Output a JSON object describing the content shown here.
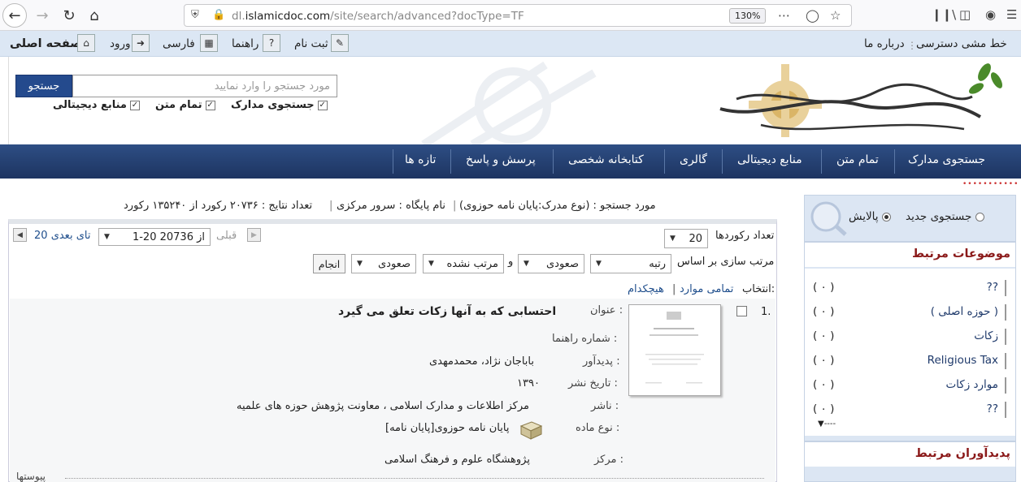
{
  "browser": {
    "url_prefix": "dl.",
    "url_domain": "islamicdoc.com",
    "url_path": "/site/search/advanced?docType=TF",
    "zoom": "130%"
  },
  "topstrip": {
    "home": "صفحه اصلی",
    "login": "ورود",
    "farsi": "فارسی",
    "help": "راهنما",
    "register": "ثبت نام",
    "accessibility": "خط مشی دسترسی",
    "about": "درباره ما"
  },
  "header": {
    "search_button": "جستجو",
    "search_placeholder": "مورد جستجو را وارد نمایید",
    "checkboxes": {
      "documents": "جستجوی مدارک",
      "fulltext": "تمام متن",
      "digital": "منابع دیجیتالی"
    }
  },
  "mainnav": {
    "items": [
      "جستجوی مدارک",
      "تمام متن",
      "منابع دیجیتالی",
      "گالری",
      "کتابخانه شخصی",
      "پرسش و پاسخ",
      "تازه ها"
    ]
  },
  "query": {
    "search_term": "مورد جستجو : (نوع مدرک:پایان نامه حوزوی)",
    "base_name": "نام پایگاه : سرور مرکزی",
    "results_count": "تعداد نتایج : ۲۰۷۳۶ رکورد از ۱۳۵۲۴۰ رکورد"
  },
  "controls": {
    "records_label": "تعداد رکوردها",
    "records_value": "20",
    "prev": "قبلی",
    "range_value": "1-20 از 20736",
    "next": "20 تای بعدی",
    "sort_label": "مرتب سازی بر اساس",
    "sort_field_1": "رتبه",
    "sort_dir_1": "صعودی",
    "and": "و",
    "sort_field_2": "مرتب نشده",
    "sort_dir_2": "صعودی",
    "apply": "انجام",
    "select_label": "انتخاب:",
    "select_all": "تمامی موارد",
    "select_none": "هیچکدام"
  },
  "record": {
    "index": "1.",
    "title_label": "عنوان :",
    "title": "احتسابی که به آنها زکات تعلق می گیرد",
    "callno_label": "شماره راهنما :",
    "creator_label": "پدیدآور :",
    "creator": "باباجان نژاد، محمدمهدی",
    "date_label": "تاریخ نشر :",
    "date": "۱۳۹۰",
    "publisher_label": "ناشر :",
    "publisher": "مرکز اطلاعات و مدارک اسلامی ، معاونت پژوهش حوزه های علمیه",
    "type_label": "نوع ماده :",
    "type": "پایان نامه حوزوی[پایان نامه]",
    "center_label": "مرکز :",
    "center": "پژوهشگاه علوم و فرهنگ اسلامی",
    "attachments": "پیوستها"
  },
  "sidebar": {
    "new_search": "جستجوی جدید",
    "refine": "پالایش",
    "topics_title": "موضوعات مرتبط",
    "topics": [
      {
        "name": "??",
        "count": "( ۰ )"
      },
      {
        "name": "( حوزه اصلی )",
        "count": "( ۰ )"
      },
      {
        "name": "زکات",
        "count": "( ۰ )"
      },
      {
        "name": "Religious Tax",
        "count": "( ۰ )"
      },
      {
        "name": "موارد زکات",
        "count": "( ۰ )"
      },
      {
        "name": "??",
        "count": "( ۰ )"
      }
    ],
    "creators_title": "پدیدآوران مرتبط"
  },
  "colors": {
    "nav_blue": "#1d3461",
    "button_blue": "#244a8d",
    "sidebar_title": "#8b1a1a",
    "link": "#1f4e8c"
  }
}
